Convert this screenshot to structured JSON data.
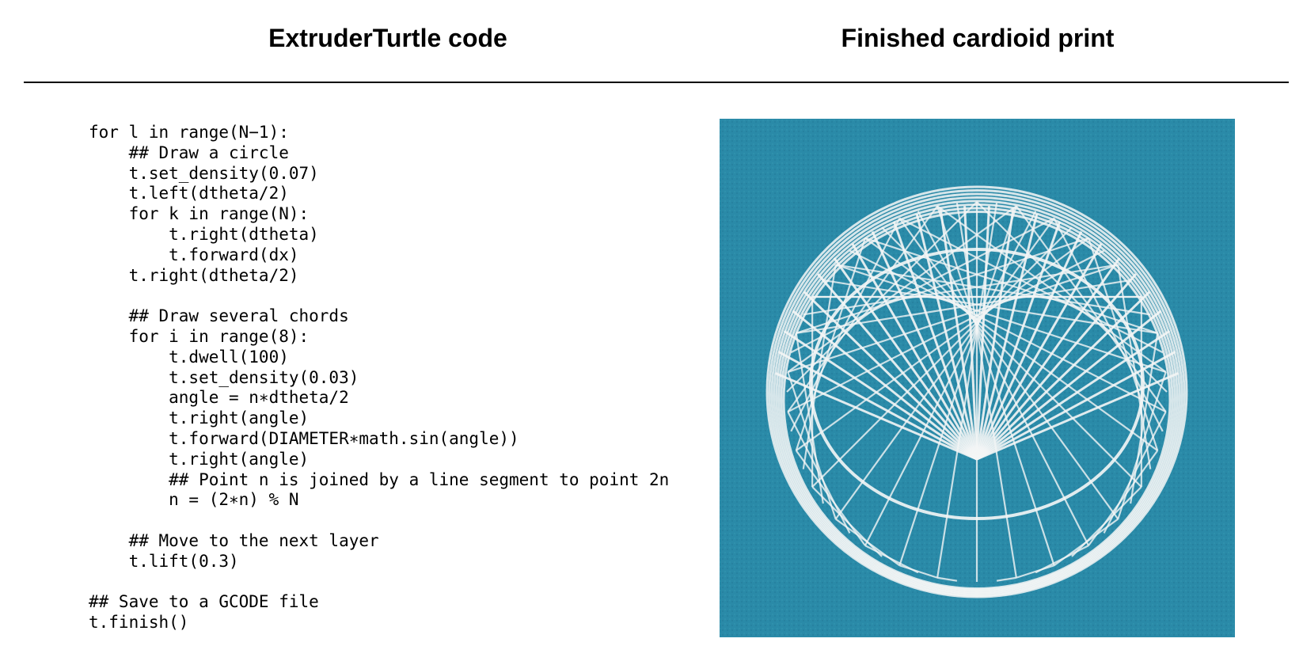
{
  "headings": {
    "left": "ExtruderTurtle code",
    "right": "Finished cardioid print"
  },
  "code_lines": [
    "for l in range(N−1):",
    "    ## Draw a circle",
    "    t.set_density(0.07)",
    "    t.left(dtheta/2)",
    "    for k in range(N):",
    "        t.right(dtheta)",
    "        t.forward(dx)",
    "    t.right(dtheta/2)",
    "",
    "    ## Draw several chords",
    "    for i in range(8):",
    "        t.dwell(100)",
    "        t.set_density(0.03)",
    "        angle = n∗dtheta/2",
    "        t.right(angle)",
    "        t.forward(DIAMETER∗math.sin(angle))",
    "        t.right(angle)",
    "        ## Point n is joined by a line segment to point 2n",
    "        n = (2∗n) % N",
    "",
    "    ## Move to the next layer",
    "    t.lift(0.3)",
    "",
    "## Save to a GCODE file",
    "t.finish()"
  ],
  "photo": {
    "background_color": "#2a8aa8",
    "print_color": "#f4f6f6"
  }
}
